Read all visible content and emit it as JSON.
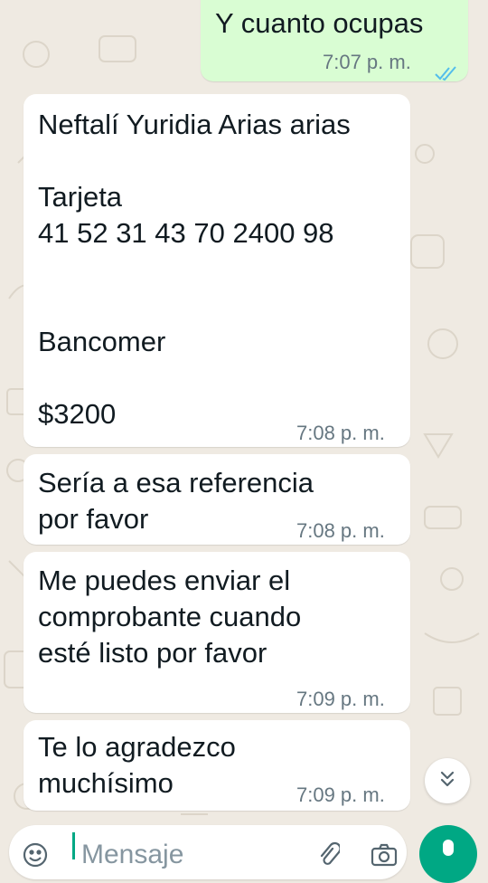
{
  "conversation": {
    "messages": [
      {
        "direction": "outgoing",
        "text": "Y cuanto ocupas",
        "time": "7:07 p. m.",
        "status_icon": "double-check-read-icon"
      },
      {
        "direction": "incoming",
        "text": "Neftalí Yuridia Arias arias\n\nTarjeta\n41 52 31 43 70 2400 98\n\n\nBancomer\n\n$3200",
        "time": "7:08 p. m."
      },
      {
        "direction": "incoming",
        "text": "Sería a esa referencia\npor favor",
        "time": "7:08 p. m."
      },
      {
        "direction": "incoming",
        "text": "Me puedes enviar el\ncomprobante cuando\nesté listo por favor",
        "time": "7:09 p. m."
      },
      {
        "direction": "incoming",
        "text": "Te lo agradezco\nmuchísimo",
        "time": "7:09 p. m."
      }
    ]
  },
  "scroll_button": {
    "icon": "double-chevron-down-icon"
  },
  "composer": {
    "placeholder": "Mensaje",
    "emoji_icon": "emoji-icon",
    "attach_icon": "paperclip-icon",
    "camera_icon": "camera-icon"
  },
  "mic_button": {
    "icon": "microphone-icon"
  },
  "colors": {
    "background": "#efeae2",
    "outgoing_bubble": "#d9fdd3",
    "incoming_bubble": "#ffffff",
    "read_tick": "#53bdeb",
    "accent": "#00a884",
    "time_text": "#667781"
  }
}
